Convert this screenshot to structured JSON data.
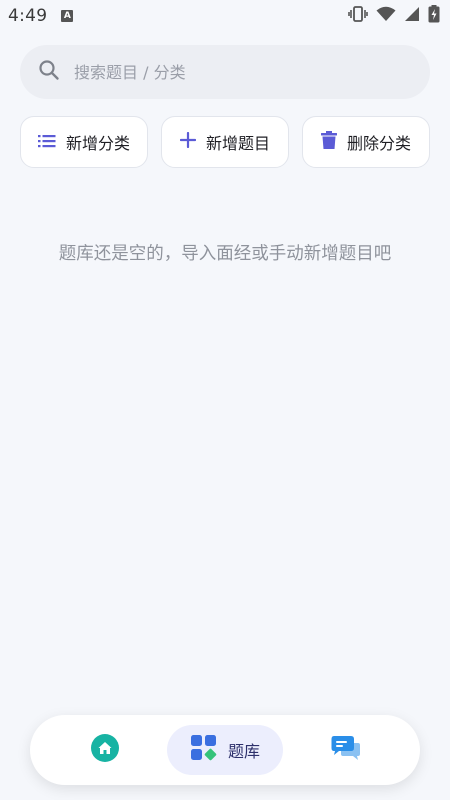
{
  "status_bar": {
    "time": "4:49",
    "notif_letter": "A"
  },
  "search": {
    "placeholder": "搜索题目 / 分类",
    "value": ""
  },
  "actions": [
    {
      "label": "新增分类",
      "icon": "list-icon"
    },
    {
      "label": "新增题目",
      "icon": "plus-icon"
    },
    {
      "label": "删除分类",
      "icon": "trash-icon"
    }
  ],
  "empty_state": {
    "message": "题库还是空的，导入面经或手动新增题目吧"
  },
  "bottom_nav": {
    "items": [
      {
        "icon": "home-icon",
        "label": ""
      },
      {
        "icon": "question-bank-icon",
        "label": "题库",
        "active": true
      },
      {
        "icon": "chat-icon",
        "label": ""
      }
    ]
  },
  "colors": {
    "background": "#f5f7fb",
    "accent": "#5b5bd6",
    "home_teal": "#17b3a3",
    "chat_blue": "#2a8ee8",
    "bank_blue": "#3a6fe0",
    "bank_green": "#35c37a"
  }
}
